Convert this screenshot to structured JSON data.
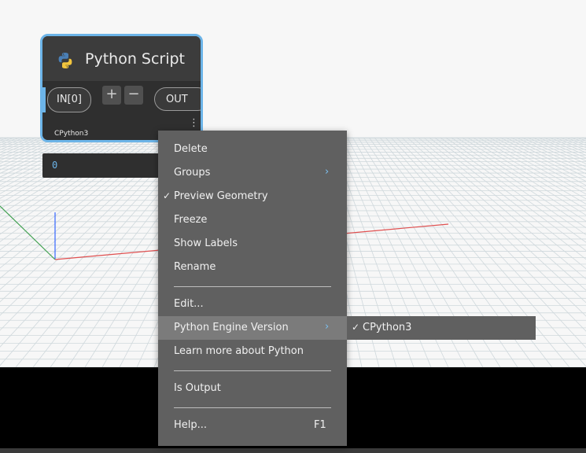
{
  "node": {
    "title": "Python Script",
    "input_port": "IN[0]",
    "output_port": "OUT",
    "add_label": "+",
    "remove_label": "−",
    "engine_label": "CPython3",
    "more_label": "⋮"
  },
  "preview": {
    "value": "0"
  },
  "context_menu": {
    "items": [
      {
        "label": "Delete"
      },
      {
        "label": "Groups",
        "arrow": "›"
      },
      {
        "label": "Preview Geometry",
        "check": "✓"
      },
      {
        "label": "Freeze"
      },
      {
        "label": "Show Labels"
      },
      {
        "label": "Rename"
      },
      {
        "label": "Edit..."
      },
      {
        "label": "Python Engine Version",
        "arrow": "›"
      },
      {
        "label": "Learn more about Python"
      },
      {
        "label": "Is Output"
      },
      {
        "label": "Help...",
        "shortcut": "F1"
      }
    ]
  },
  "submenu": {
    "check": "✓",
    "label": "CPython3"
  },
  "colors": {
    "accent": "#6cb4e8",
    "menu_bg": "#606060",
    "highlight": "#7b7b7b"
  }
}
